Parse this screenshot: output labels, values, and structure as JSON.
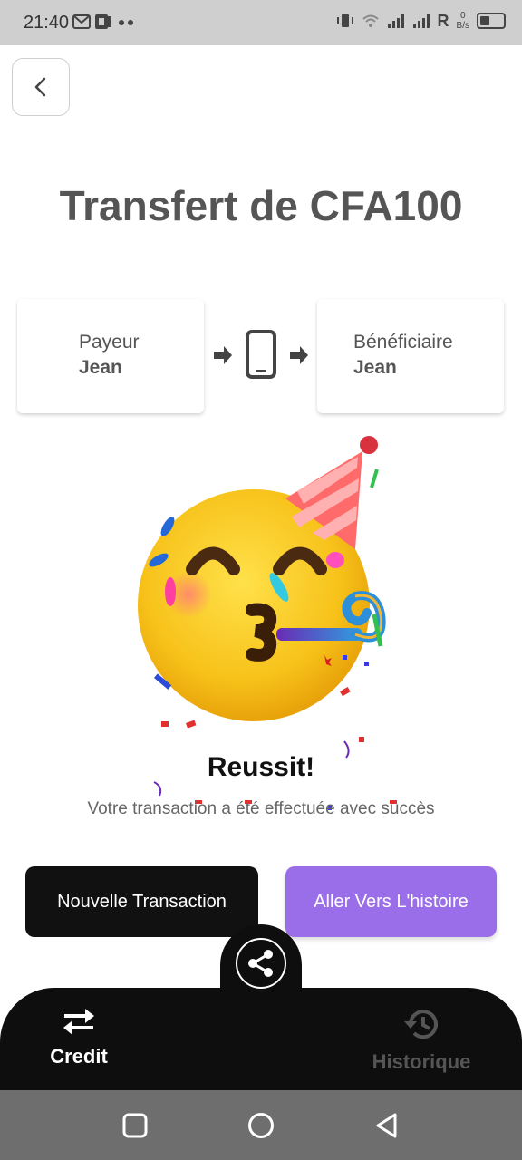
{
  "status_bar": {
    "time": "21:40",
    "network_letter": "R",
    "speed_value": "0",
    "speed_unit": "B/s"
  },
  "header": {
    "back_icon": "chevron-left-icon"
  },
  "title": "Transfert de CFA100",
  "payer": {
    "role": "Payeur",
    "name": "Jean"
  },
  "beneficiary": {
    "role": "Bénéficiaire",
    "name": "Jean"
  },
  "flow_icon": "phone-icon",
  "success": {
    "title": "Reussit!",
    "message": "Votre transaction a été effectuée avec succès"
  },
  "actions": {
    "new_transaction": "Nouvelle Transaction",
    "go_history": "Aller Vers L'histoire"
  },
  "bottom_nav": {
    "share_icon": "share-icon",
    "items": [
      {
        "label": "Credit",
        "icon": "swap-arrows-icon",
        "active": true
      },
      {
        "label": "Historique",
        "icon": "history-icon",
        "active": false
      }
    ]
  },
  "colors": {
    "accent_purple": "#9a6ee8",
    "dark": "#111111",
    "title_gray": "#555555"
  }
}
